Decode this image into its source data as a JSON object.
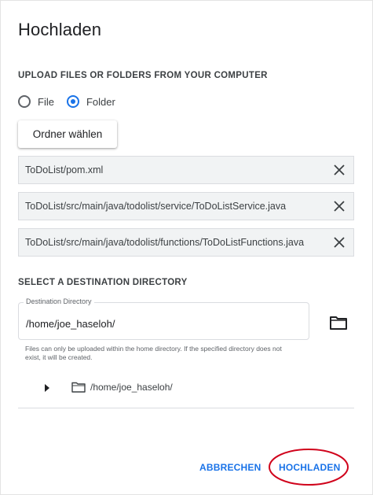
{
  "dialog": {
    "title": "Hochladen"
  },
  "upload": {
    "section_label": "UPLOAD FILES OR FOLDERS FROM YOUR COMPUTER",
    "radio_options": [
      {
        "label": "File",
        "checked": false
      },
      {
        "label": "Folder",
        "checked": true
      }
    ],
    "choose_button_label": "Ordner wählen",
    "files": [
      {
        "name": "ToDoList/pom.xml"
      },
      {
        "name": "ToDoList/src/main/java/todolist/service/ToDoListService.java"
      },
      {
        "name": "ToDoList/src/main/java/todolist/functions/ToDoListFunctions.java"
      }
    ],
    "remove_icon": "close-icon"
  },
  "destination": {
    "section_label": "SELECT A DESTINATION DIRECTORY",
    "field_label": "Destination Directory",
    "field_value": "/home/joe_haseloh/",
    "browse_icon": "folder-icon",
    "hint": "Files can only be uploaded within the home directory. If the specified directory does not exist, it will be created.",
    "tree": {
      "toggle_icon": "caret-right-icon",
      "folder_icon": "folder-icon",
      "label": "/home/joe_haseloh/"
    }
  },
  "actions": {
    "cancel_label": "ABBRECHEN",
    "upload_label": "HOCHLADEN"
  },
  "colors": {
    "accent": "#1a73e8",
    "highlight_annotation": "#d0021b"
  }
}
